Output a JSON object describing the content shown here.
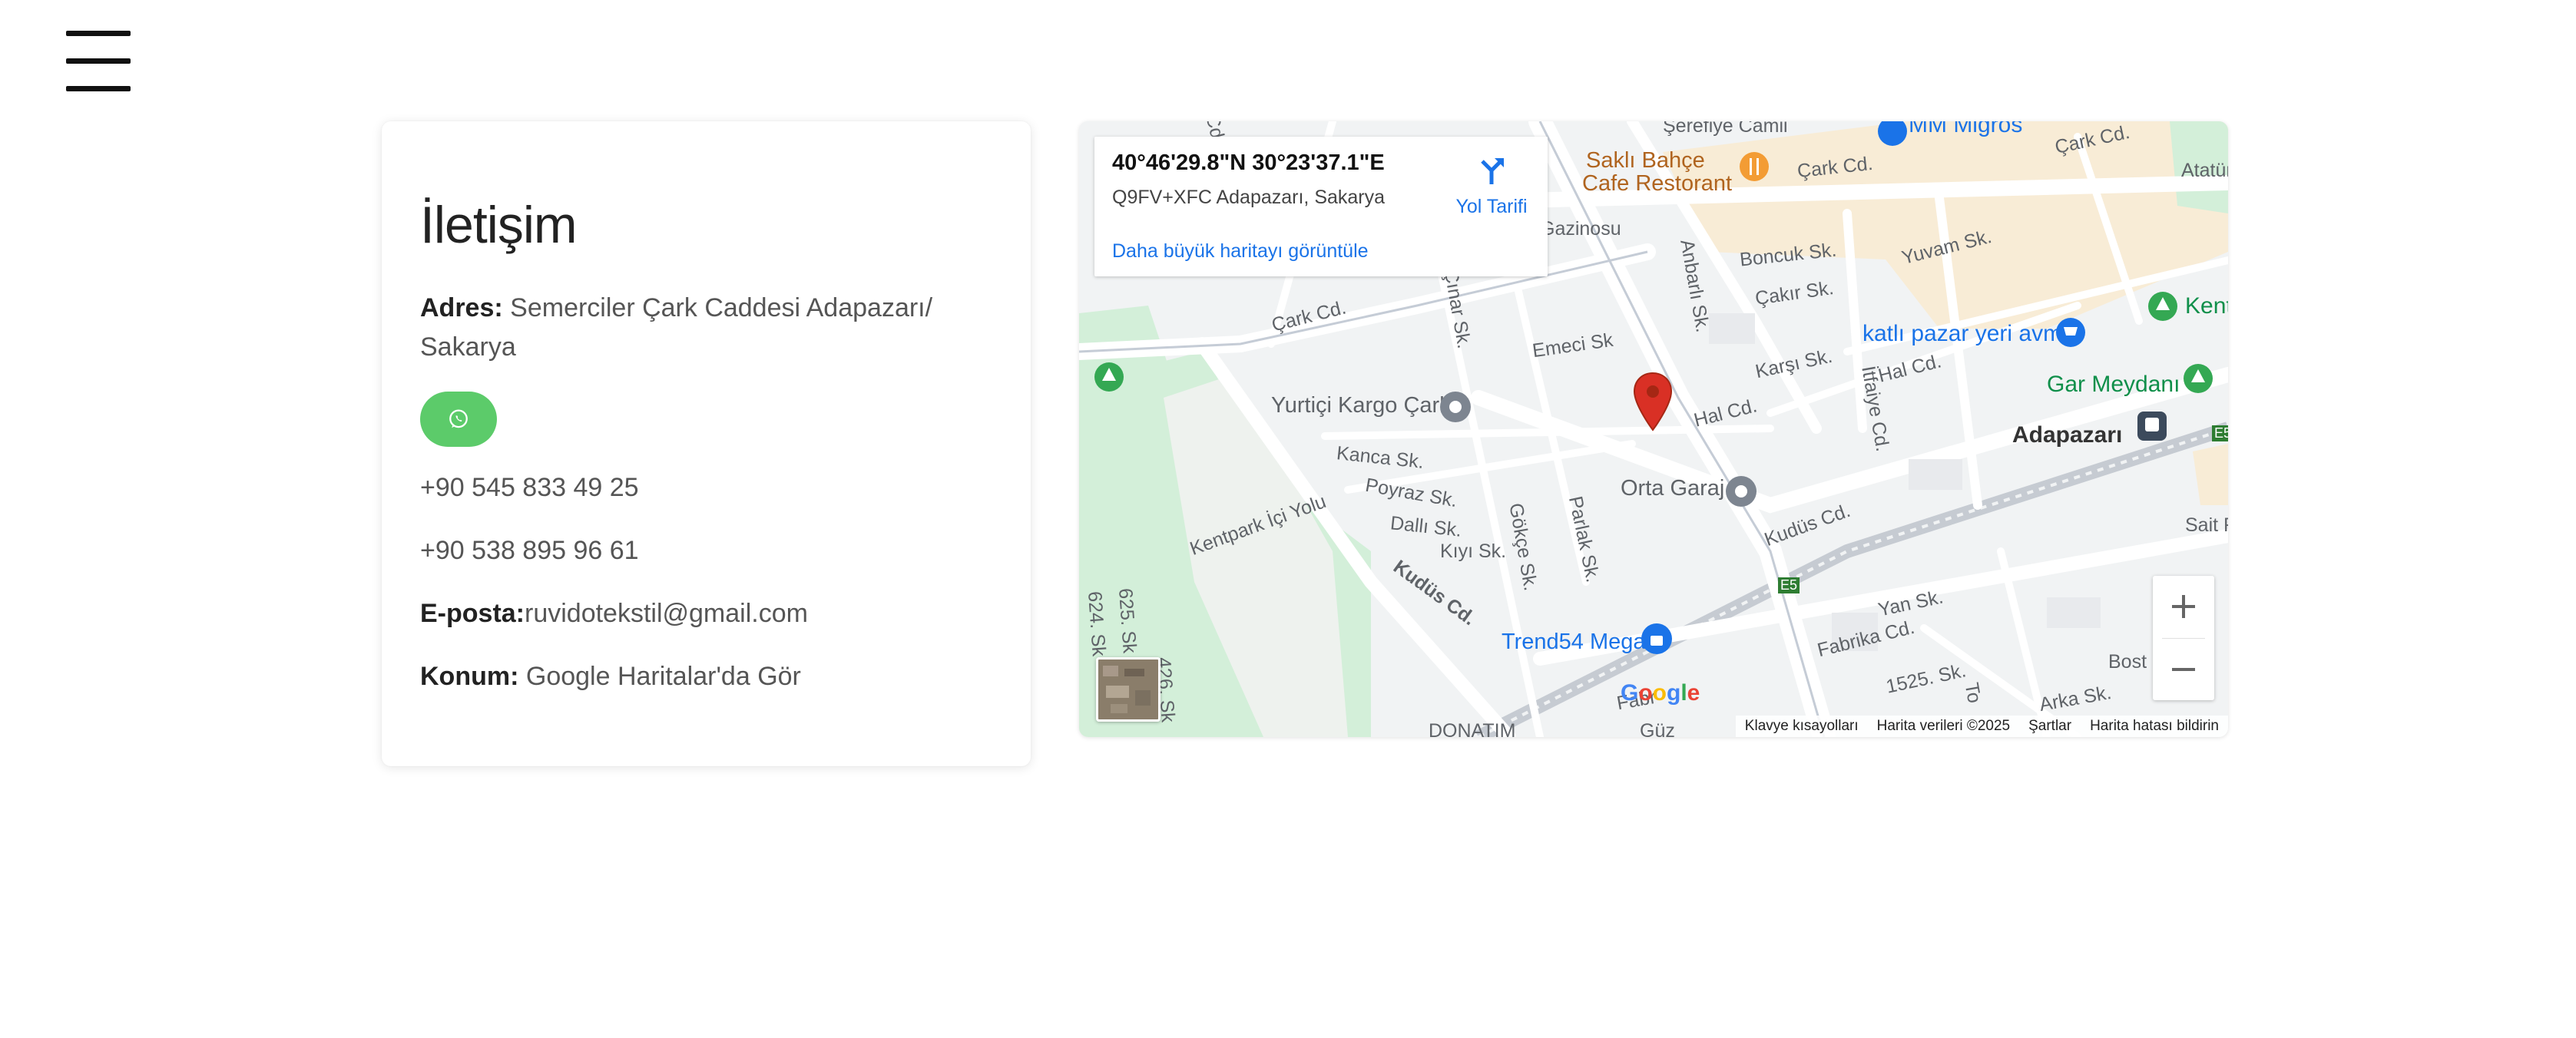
{
  "nav": {
    "menu_icon": "hamburger-menu-icon"
  },
  "contact": {
    "title": "İletişim",
    "address_label": "Adres:",
    "address_value": "Semerciler Çark Caddesi Adapazarı/ Sakarya",
    "whatsapp_icon": "whatsapp-icon",
    "whatsapp_color": "#5ccb6a",
    "phone_1": "+90 545 833 49 25",
    "phone_2": "+90 538 895 96 61",
    "email_label": "E-posta:",
    "email_value": "ruvidotekstil@gmail.com",
    "location_label": "Konum:",
    "location_link": "Google Haritalar'da Gör"
  },
  "map": {
    "info": {
      "coordinates": "40°46'29.8\"N 30°23'37.1\"E",
      "plus_code": "Q9FV+XFC Adapazarı, Sakarya",
      "bigger_map_link": "Daha büyük haritayı görüntüle",
      "directions_label": "Yol Tarifi"
    },
    "labels": {
      "serefiye": "Şerefiye Camii",
      "mm_migros": "MM Migros",
      "sakli_bahce_1": "Saklı Bahçe",
      "sakli_bahce_2": "Cafe Restorant",
      "cark_cd_1": "Çark Cd.",
      "cark_cd_2": "Çark Cd.",
      "cark_cd_3": "Çark Cd.",
      "cark_cd_4": "Çark Cd.",
      "atatur": "Atatür",
      "gazinosu": "Gazinosu",
      "boncuk": "Boncuk Sk.",
      "yuvam": "Yuvam Sk.",
      "anbarli": "Anbarlı Sk.",
      "cakir": "Çakır Sk.",
      "kent": "Kent",
      "katli_pazar": "katlı pazar yeri avm",
      "cinar": "Çınar Sk.",
      "emeci": "Emeci Sk",
      "karsi": "Karşı Sk.",
      "hal_cd_1": "Hal Cd.",
      "hal_cd_2": "Hal Cd.",
      "itfaiye": "İtfaiye Cd.",
      "gar_meydani": "Gar Meydanı",
      "yurtici": "Yurtiçi Kargo Çark",
      "adapazari": "Adapazarı",
      "e5_1": "E5",
      "e5_2": "E5",
      "kanca": "Kanca Sk.",
      "poyraz": "Poyraz Sk.",
      "dalli": "Dallı Sk.",
      "kiyi": "Kıyı Sk.",
      "orta_garaj": "Orta Garaj",
      "gokce": "Gökçe Sk.",
      "parlak": "Parlak Sk.",
      "kentpark": "Kentpark İçi Yolu",
      "kudus_1": "Kudüs Cd.",
      "kudus_2": "Kudüs Cd.",
      "sait": "Sait F",
      "yan": "Yan Sk.",
      "fabrika_1": "Fabrika Cd.",
      "fabrika_2": "Fabr",
      "trend54": "Trend54 Mega",
      "bost": "Bost",
      "sk1525": "1525. Sk.",
      "arka": "Arka Sk.",
      "sk624": "624. Sk",
      "sk625": "625. Sk",
      "sk426": "426. Sk",
      "donatim": "DONATIM",
      "guz": "Güz",
      "cd_top": "Cd",
      "to_frag": "To"
    },
    "pin_color": "#d93025",
    "zoom_in_icon": "plus-icon",
    "zoom_out_icon": "minus-icon",
    "google_logo": "Google",
    "footer": {
      "shortcuts": "Klavye kısayolları",
      "map_data": "Harita verileri ©2025",
      "terms": "Şartlar",
      "report": "Harita hatası bildirin"
    }
  }
}
